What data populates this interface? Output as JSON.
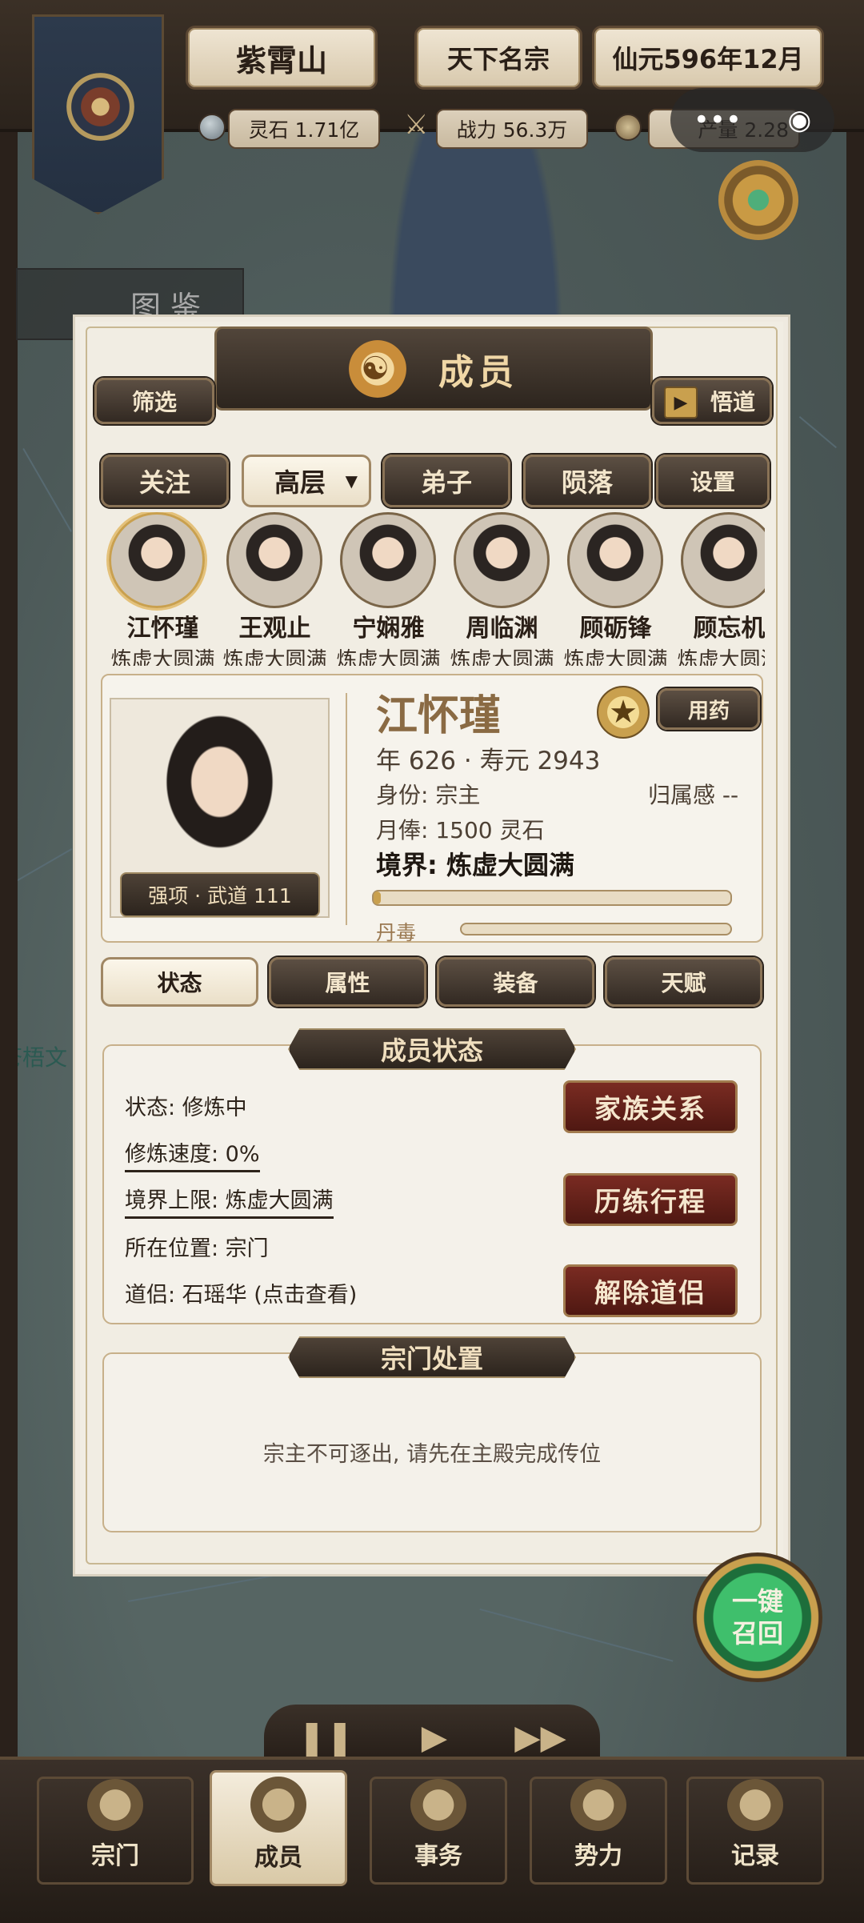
{
  "topbar": {
    "sect_name": "紫霄山",
    "sect_rank": "天下名宗",
    "date": "仙元596年12月",
    "spirit_stone": "灵石 1.71亿",
    "combat_power": "战力 56.3万",
    "production": "产量 2.28"
  },
  "capsule": {
    "more_icon": "•••",
    "close_icon": "◉"
  },
  "map": {
    "tujian_label": "图鉴",
    "place_label": "苍梧文"
  },
  "panel": {
    "title": "成员",
    "filter_label": "筛选",
    "enlighten_label": "悟道",
    "tabs": [
      "关注",
      "高层",
      "弟子",
      "陨落",
      "设置"
    ],
    "members": [
      {
        "name": "江怀瑾",
        "realm": "炼虚大圆满"
      },
      {
        "name": "王观止",
        "realm": "炼虚大圆满"
      },
      {
        "name": "宁娴雅",
        "realm": "炼虚大圆满"
      },
      {
        "name": "周临渊",
        "realm": "炼虚大圆满"
      },
      {
        "name": "顾砺锋",
        "realm": "炼虚大圆满"
      },
      {
        "name": "顾忘机",
        "realm": "炼虚大圆满"
      }
    ],
    "detail": {
      "name": "江怀瑾",
      "strength": "强项 · 武道 111",
      "medicine_label": "用药",
      "age_line": "年 626 · 寿元 2943",
      "identity": "身份: 宗主",
      "belonging": "归属感 --",
      "salary": "月俸: 1500 灵石",
      "realm": "境界: 炼虚大圆满",
      "pill_poison_label": "丹毒",
      "progress": 0.02,
      "poison": 0.0
    },
    "subtabs": [
      "状态",
      "属性",
      "装备",
      "天赋"
    ],
    "status_section": {
      "title": "成员状态",
      "state": "状态: 修炼中",
      "speed": "修炼速度: 0%",
      "limit": "境界上限: 炼虚大圆满",
      "location": "所在位置: 宗门",
      "partner": "道侣: 石瑶华 (点击查看)",
      "family_btn": "家族关系",
      "travel_btn": "历练行程",
      "divorce_btn": "解除道侣"
    },
    "sect_section": {
      "title": "宗门处置",
      "message": "宗主不可逐出, 请先在主殿完成传位"
    }
  },
  "recall": {
    "label": "一键召回"
  },
  "playback": {
    "pause": "❚❚",
    "play": "▶",
    "fast": "▶▶"
  },
  "nav": [
    {
      "label": "宗门",
      "icon": "sect-gate-icon"
    },
    {
      "label": "成员",
      "icon": "member-icon"
    },
    {
      "label": "事务",
      "icon": "scroll-icon"
    },
    {
      "label": "势力",
      "icon": "banner-icon"
    },
    {
      "label": "记录",
      "icon": "book-icon"
    }
  ]
}
